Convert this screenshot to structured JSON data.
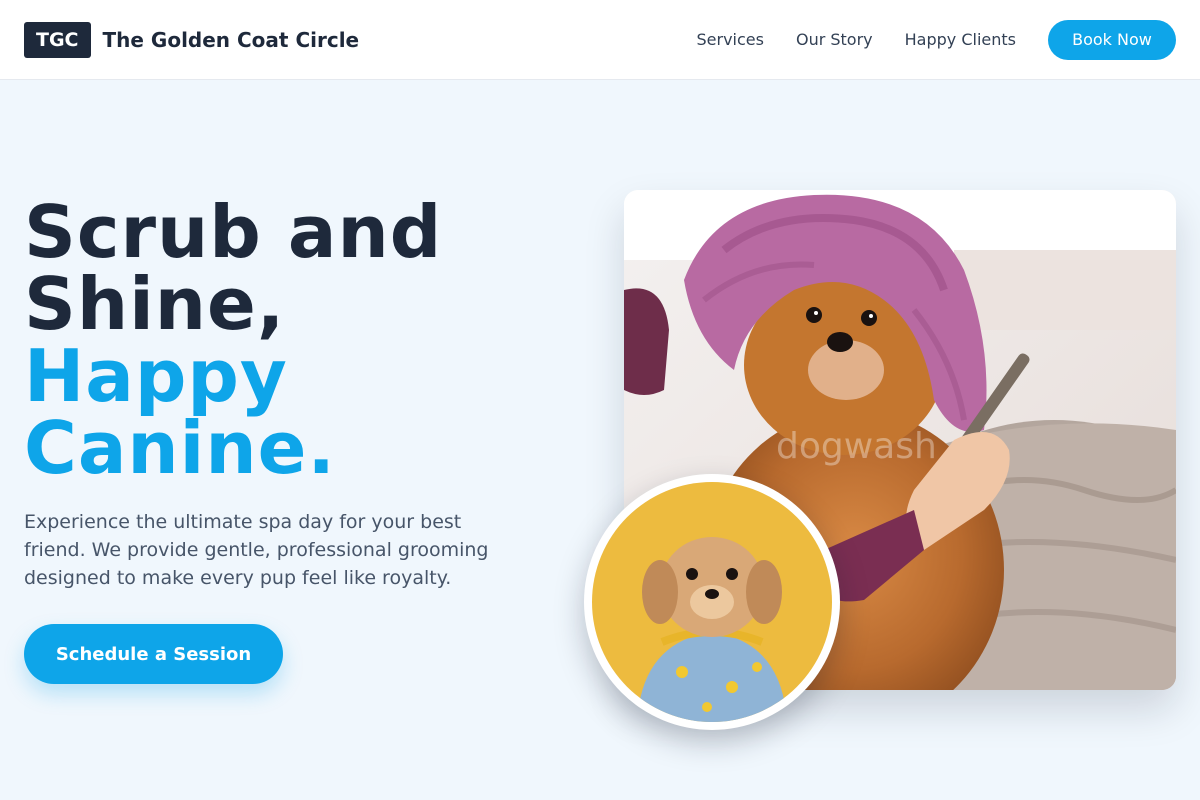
{
  "header": {
    "logo_text": "TGC",
    "brand_name": "The Golden Coat Circle",
    "nav": [
      {
        "label": "Services"
      },
      {
        "label": "Our Story"
      },
      {
        "label": "Happy Clients"
      }
    ],
    "book_label": "Book Now"
  },
  "hero": {
    "title_line1": "Scrub and",
    "title_line2": "Shine,",
    "title_line3": "Happy",
    "title_line4": "Canine.",
    "description": "Experience the ultimate spa day for your best friend. We provide gentle, professional grooming designed to make every pup feel like royalty.",
    "cta_label": "Schedule a Session"
  },
  "images": {
    "main_watermark": "dogwash"
  },
  "colors": {
    "accent": "#0ea5e9",
    "dark": "#1e293b",
    "background": "#f0f7fd"
  }
}
